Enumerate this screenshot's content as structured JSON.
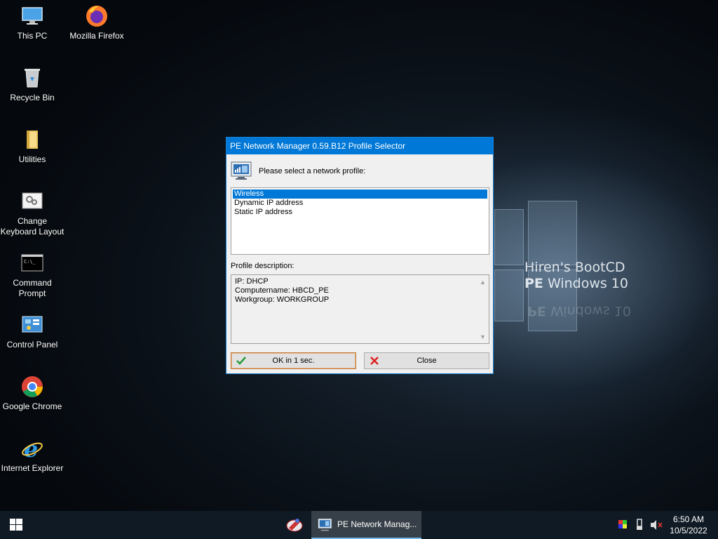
{
  "desktop": {
    "icons": [
      {
        "label_line1": "This PC",
        "label_line2": "",
        "icon": "computer-icon"
      },
      {
        "label_line1": "Mozilla Firefox",
        "label_line2": "",
        "icon": "firefox-icon"
      },
      {
        "label_line1": "Recycle Bin",
        "label_line2": "",
        "icon": "recycle-bin-icon"
      },
      {
        "label_line1": "Utilities",
        "label_line2": "",
        "icon": "folder-icon"
      },
      {
        "label_line1": "Change",
        "label_line2": "Keyboard Layout",
        "icon": "keyboard-layout-icon"
      },
      {
        "label_line1": "Command",
        "label_line2": "Prompt",
        "icon": "command-prompt-icon"
      },
      {
        "label_line1": "Control Panel",
        "label_line2": "",
        "icon": "control-panel-icon"
      },
      {
        "label_line1": "Google Chrome",
        "label_line2": "",
        "icon": "chrome-icon"
      },
      {
        "label_line1": "Internet Explorer",
        "label_line2": "",
        "icon": "internet-explorer-icon"
      }
    ],
    "wallpaper": {
      "line1": "Hiren's BootCD",
      "line2_bold": "PE",
      "line2_rest": " Windows 10"
    }
  },
  "dialog": {
    "title": "PE Network Manager 0.59.B12 Profile Selector",
    "prompt": "Please select a network profile:",
    "profiles": [
      "Wireless",
      "Dynamic IP address",
      "Static IP address"
    ],
    "selected_index": 0,
    "description_label": "Profile description:",
    "description_lines": [
      "IP: DHCP",
      "Computername: HBCD_PE",
      "Workgroup: WORKGROUP"
    ],
    "ok_label": "OK in 1 sec.",
    "close_label": "Close"
  },
  "taskbar": {
    "active_app_label": "PE Network Manag...",
    "time": "6:50 AM",
    "date": "10/5/2022"
  },
  "colors": {
    "accent": "#0078d7",
    "taskbar": "#0f1a24",
    "dialog_bg": "#f0f0f0"
  }
}
